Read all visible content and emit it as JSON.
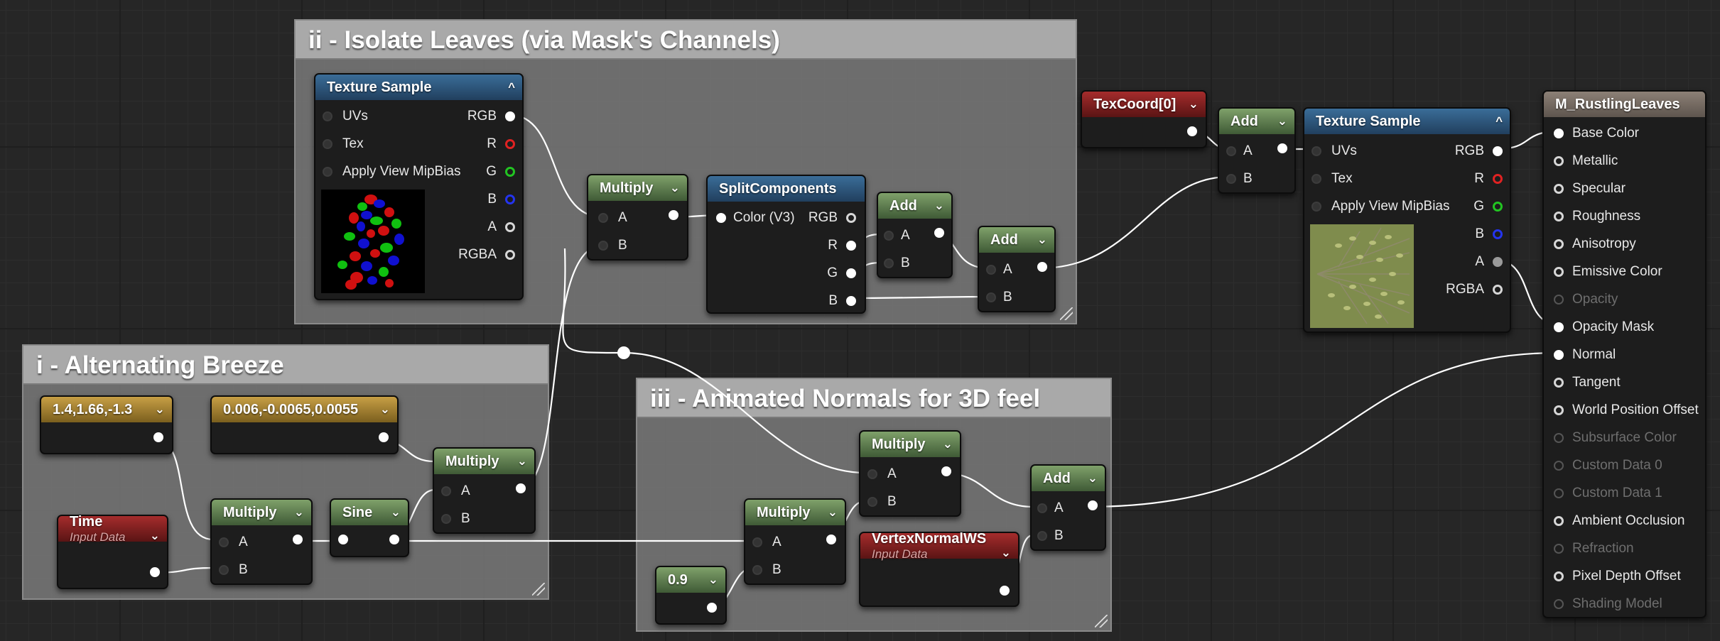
{
  "colors": {
    "canvas": "#262626",
    "wire": "#ffffff",
    "node_body": "#1d1d1d",
    "comment_bg": "#787878",
    "header_blue": "#2e5a80",
    "header_green": "#5c7d4f",
    "header_red": "#8c2020",
    "header_gold": "#b08a35",
    "header_result": "#7a6e66"
  },
  "comments": {
    "isolate": {
      "title": "ii - Isolate Leaves (via Mask's Channels)"
    },
    "breeze": {
      "title": "i - Alternating Breeze"
    },
    "normals": {
      "title": "iii - Animated Normals for 3D feel"
    }
  },
  "nodes": {
    "tex_sample_mask": {
      "title": "Texture Sample",
      "inputs": [
        "UVs",
        "Tex",
        "Apply View MipBias"
      ],
      "outputs": [
        "RGB",
        "R",
        "G",
        "B",
        "A",
        "RGBA"
      ],
      "thumbnail": "rgb-mask-thumbnail"
    },
    "multiply_mask": {
      "title": "Multiply",
      "inputs": [
        "A",
        "B"
      ]
    },
    "split_components": {
      "title": "SplitComponents",
      "input": "Color (V3)",
      "outputs": [
        "RGB",
        "R",
        "G",
        "B"
      ]
    },
    "add_rg": {
      "title": "Add",
      "inputs": [
        "A",
        "B"
      ]
    },
    "add_rgb": {
      "title": "Add",
      "inputs": [
        "A",
        "B"
      ]
    },
    "const_breeze_a": {
      "value": "1.4,1.66,-1.3"
    },
    "const_breeze_b": {
      "value": "0.006,-0.0065,0.0055"
    },
    "time": {
      "title": "Time",
      "subtitle": "Input Data"
    },
    "multiply_time": {
      "title": "Multiply",
      "inputs": [
        "A",
        "B"
      ]
    },
    "sine": {
      "title": "Sine"
    },
    "multiply_breeze": {
      "title": "Multiply",
      "inputs": [
        "A",
        "B"
      ]
    },
    "texcoord": {
      "title": "TexCoord[0]"
    },
    "add_uv": {
      "title": "Add",
      "inputs": [
        "A",
        "B"
      ]
    },
    "tex_sample_leaves": {
      "title": "Texture Sample",
      "inputs": [
        "UVs",
        "Tex",
        "Apply View MipBias"
      ],
      "outputs": [
        "RGB",
        "R",
        "G",
        "B",
        "A",
        "RGBA"
      ],
      "thumbnail": "leaves-thumbnail"
    },
    "multiply_normal_a": {
      "title": "Multiply",
      "inputs": [
        "A",
        "B"
      ]
    },
    "multiply_normal_b": {
      "title": "Multiply",
      "inputs": [
        "A",
        "B"
      ]
    },
    "const_09": {
      "value": "0.9"
    },
    "vertex_normal": {
      "title": "VertexNormalWS",
      "subtitle": "Input Data"
    },
    "add_normal": {
      "title": "Add",
      "inputs": [
        "A",
        "B"
      ]
    }
  },
  "result": {
    "title": "M_RustlingLeaves",
    "pins": [
      {
        "label": "Base Color",
        "enabled": true
      },
      {
        "label": "Metallic",
        "enabled": true
      },
      {
        "label": "Specular",
        "enabled": true
      },
      {
        "label": "Roughness",
        "enabled": true
      },
      {
        "label": "Anisotropy",
        "enabled": true
      },
      {
        "label": "Emissive Color",
        "enabled": true
      },
      {
        "label": "Opacity",
        "enabled": false
      },
      {
        "label": "Opacity Mask",
        "enabled": true
      },
      {
        "label": "Normal",
        "enabled": true
      },
      {
        "label": "Tangent",
        "enabled": true
      },
      {
        "label": "World Position Offset",
        "enabled": true
      },
      {
        "label": "Subsurface Color",
        "enabled": false
      },
      {
        "label": "Custom Data 0",
        "enabled": false
      },
      {
        "label": "Custom Data 1",
        "enabled": false
      },
      {
        "label": "Ambient Occlusion",
        "enabled": true
      },
      {
        "label": "Refraction",
        "enabled": false
      },
      {
        "label": "Pixel Depth Offset",
        "enabled": true
      },
      {
        "label": "Shading Model",
        "enabled": false
      }
    ]
  }
}
